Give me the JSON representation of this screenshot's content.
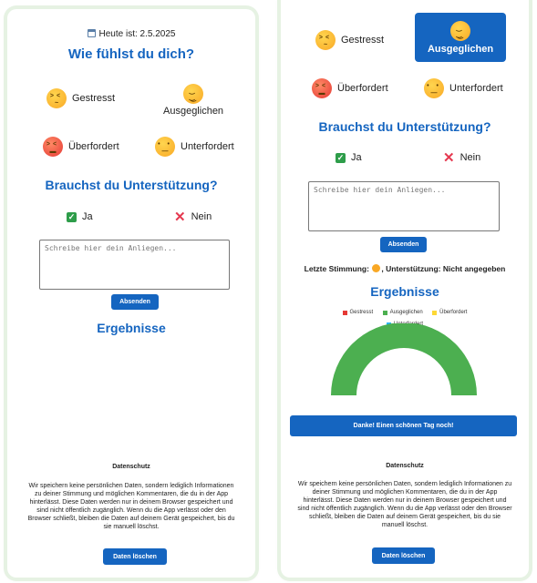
{
  "left": {
    "date_line": "Heute ist: 2.5.2025",
    "question": "Wie fühlst du dich?",
    "moods": {
      "gestresst": "Gestresst",
      "ausgeglichen": "Ausgeglichen",
      "ueberfordert": "Überfordert",
      "unterfordert": "Unterfordert"
    },
    "support_question": "Brauchst du Unterstützung?",
    "yes": "Ja",
    "no": "Nein",
    "textarea_placeholder": "Schreibe hier dein Anliegen...",
    "send_button": "Absenden",
    "results_title": "Ergebnisse",
    "privacy_title": "Datenschutz",
    "privacy_text": "Wir speichern keine persönlichen Daten, sondern lediglich Informationen zu deiner Stimmung und möglichen Kommentaren, die du in der App hinterlässt. Diese Daten werden nur in deinem Browser gespeichert und sind nicht öffentlich zugänglich. Wenn du die App verlässt oder den Browser schließt, bleiben die Daten auf deinem Gerät gespeichert, bis du sie manuell löschst.",
    "delete_button": "Daten löschen"
  },
  "right": {
    "moods": {
      "gestresst": "Gestresst",
      "ausgeglichen": "Ausgeglichen",
      "ueberfordert": "Überfordert",
      "unterfordert": "Unterfordert"
    },
    "selected_mood": "ausgeglichen",
    "support_question": "Brauchst du Unterstützung?",
    "yes": "Ja",
    "no": "Nein",
    "textarea_placeholder": "Schreibe hier dein Anliegen...",
    "send_button": "Absenden",
    "last_mood_label": "Letzte Stimmung:",
    "last_support": ", Unterstützung: Nicht angegeben",
    "results_title": "Ergebnisse",
    "thanks_button": "Danke! Einen schönen Tag noch!",
    "privacy_title": "Datenschutz",
    "privacy_text": "Wir speichern keine persönlichen Daten, sondern lediglich Informationen zu deiner Stimmung und möglichen Kommentaren, die du in der App hinterlässt. Diese Daten werden nur in deinem Browser gespeichert und sind nicht öffentlich zugänglich. Wenn du die App verlässt oder den Browser schließt, bleiben die Daten auf deinem Gerät gespeichert, bis du sie manuell löschst.",
    "delete_button": "Daten löschen"
  },
  "icons": {
    "calendar": "calendar-icon",
    "gestresst": "confounded-face-icon",
    "ausgeglichen": "relieved-face-icon",
    "ueberfordert": "tired-face-icon",
    "unterfordert": "neutral-face-icon",
    "yes": "check-box-icon",
    "no": "cross-mark-icon"
  },
  "colors": {
    "primary": "#1565c0",
    "gestresst": "#e53935",
    "ausgeglichen": "#4caf50",
    "ueberfordert": "#fdd835",
    "unterfordert": "#29b6f6"
  },
  "chart_data": {
    "type": "pie",
    "style": "half-donut",
    "categories": [
      "Gestresst",
      "Ausgeglichen",
      "Überfordert",
      "Unterfordert"
    ],
    "values": [
      0,
      1,
      0,
      0
    ],
    "colors": [
      "#e53935",
      "#4caf50",
      "#fdd835",
      "#29b6f6"
    ],
    "legend_position": "top"
  }
}
